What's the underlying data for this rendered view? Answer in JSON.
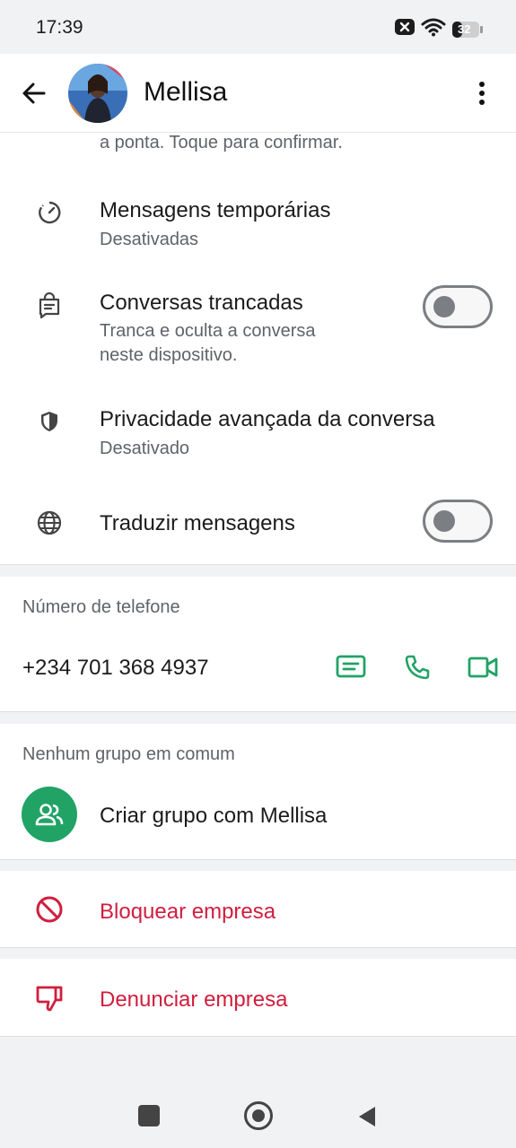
{
  "status_bar": {
    "time": "17:39",
    "battery": "32"
  },
  "header": {
    "back_icon": "arrow-left-icon",
    "contact_name": "Mellisa",
    "more_icon": "more-vert-icon"
  },
  "settings": {
    "cut_text_line": "a ponta. Toque para confirmar.",
    "items": [
      {
        "title": "Mensagens temporárias",
        "subtitle": "Desativadas",
        "icon": "timer-icon"
      },
      {
        "title": "Conversas trancadas",
        "subtitle_line1": "Tranca e oculta a conversa",
        "subtitle_line2": "neste dispositivo.",
        "icon": "locked-chat-icon",
        "toggle": false
      },
      {
        "title": "Privacidade avançada da conversa",
        "subtitle": "Desativado",
        "icon": "shield-icon"
      },
      {
        "title": "Traduzir mensagens",
        "icon": "globe-icon",
        "toggle": false
      }
    ]
  },
  "phone": {
    "label": "Número de telefone",
    "number": "+234 701 368 4937",
    "actions": [
      "message-icon",
      "phone-icon",
      "video-icon"
    ]
  },
  "groups": {
    "label": "Nenhum grupo em comum",
    "create_label": "Criar grupo com Mellisa"
  },
  "actions": {
    "block_label": "Bloquear empresa",
    "report_label": "Denunciar empresa"
  },
  "colors": {
    "accent": "#21a366",
    "danger": "#d01e3e"
  }
}
